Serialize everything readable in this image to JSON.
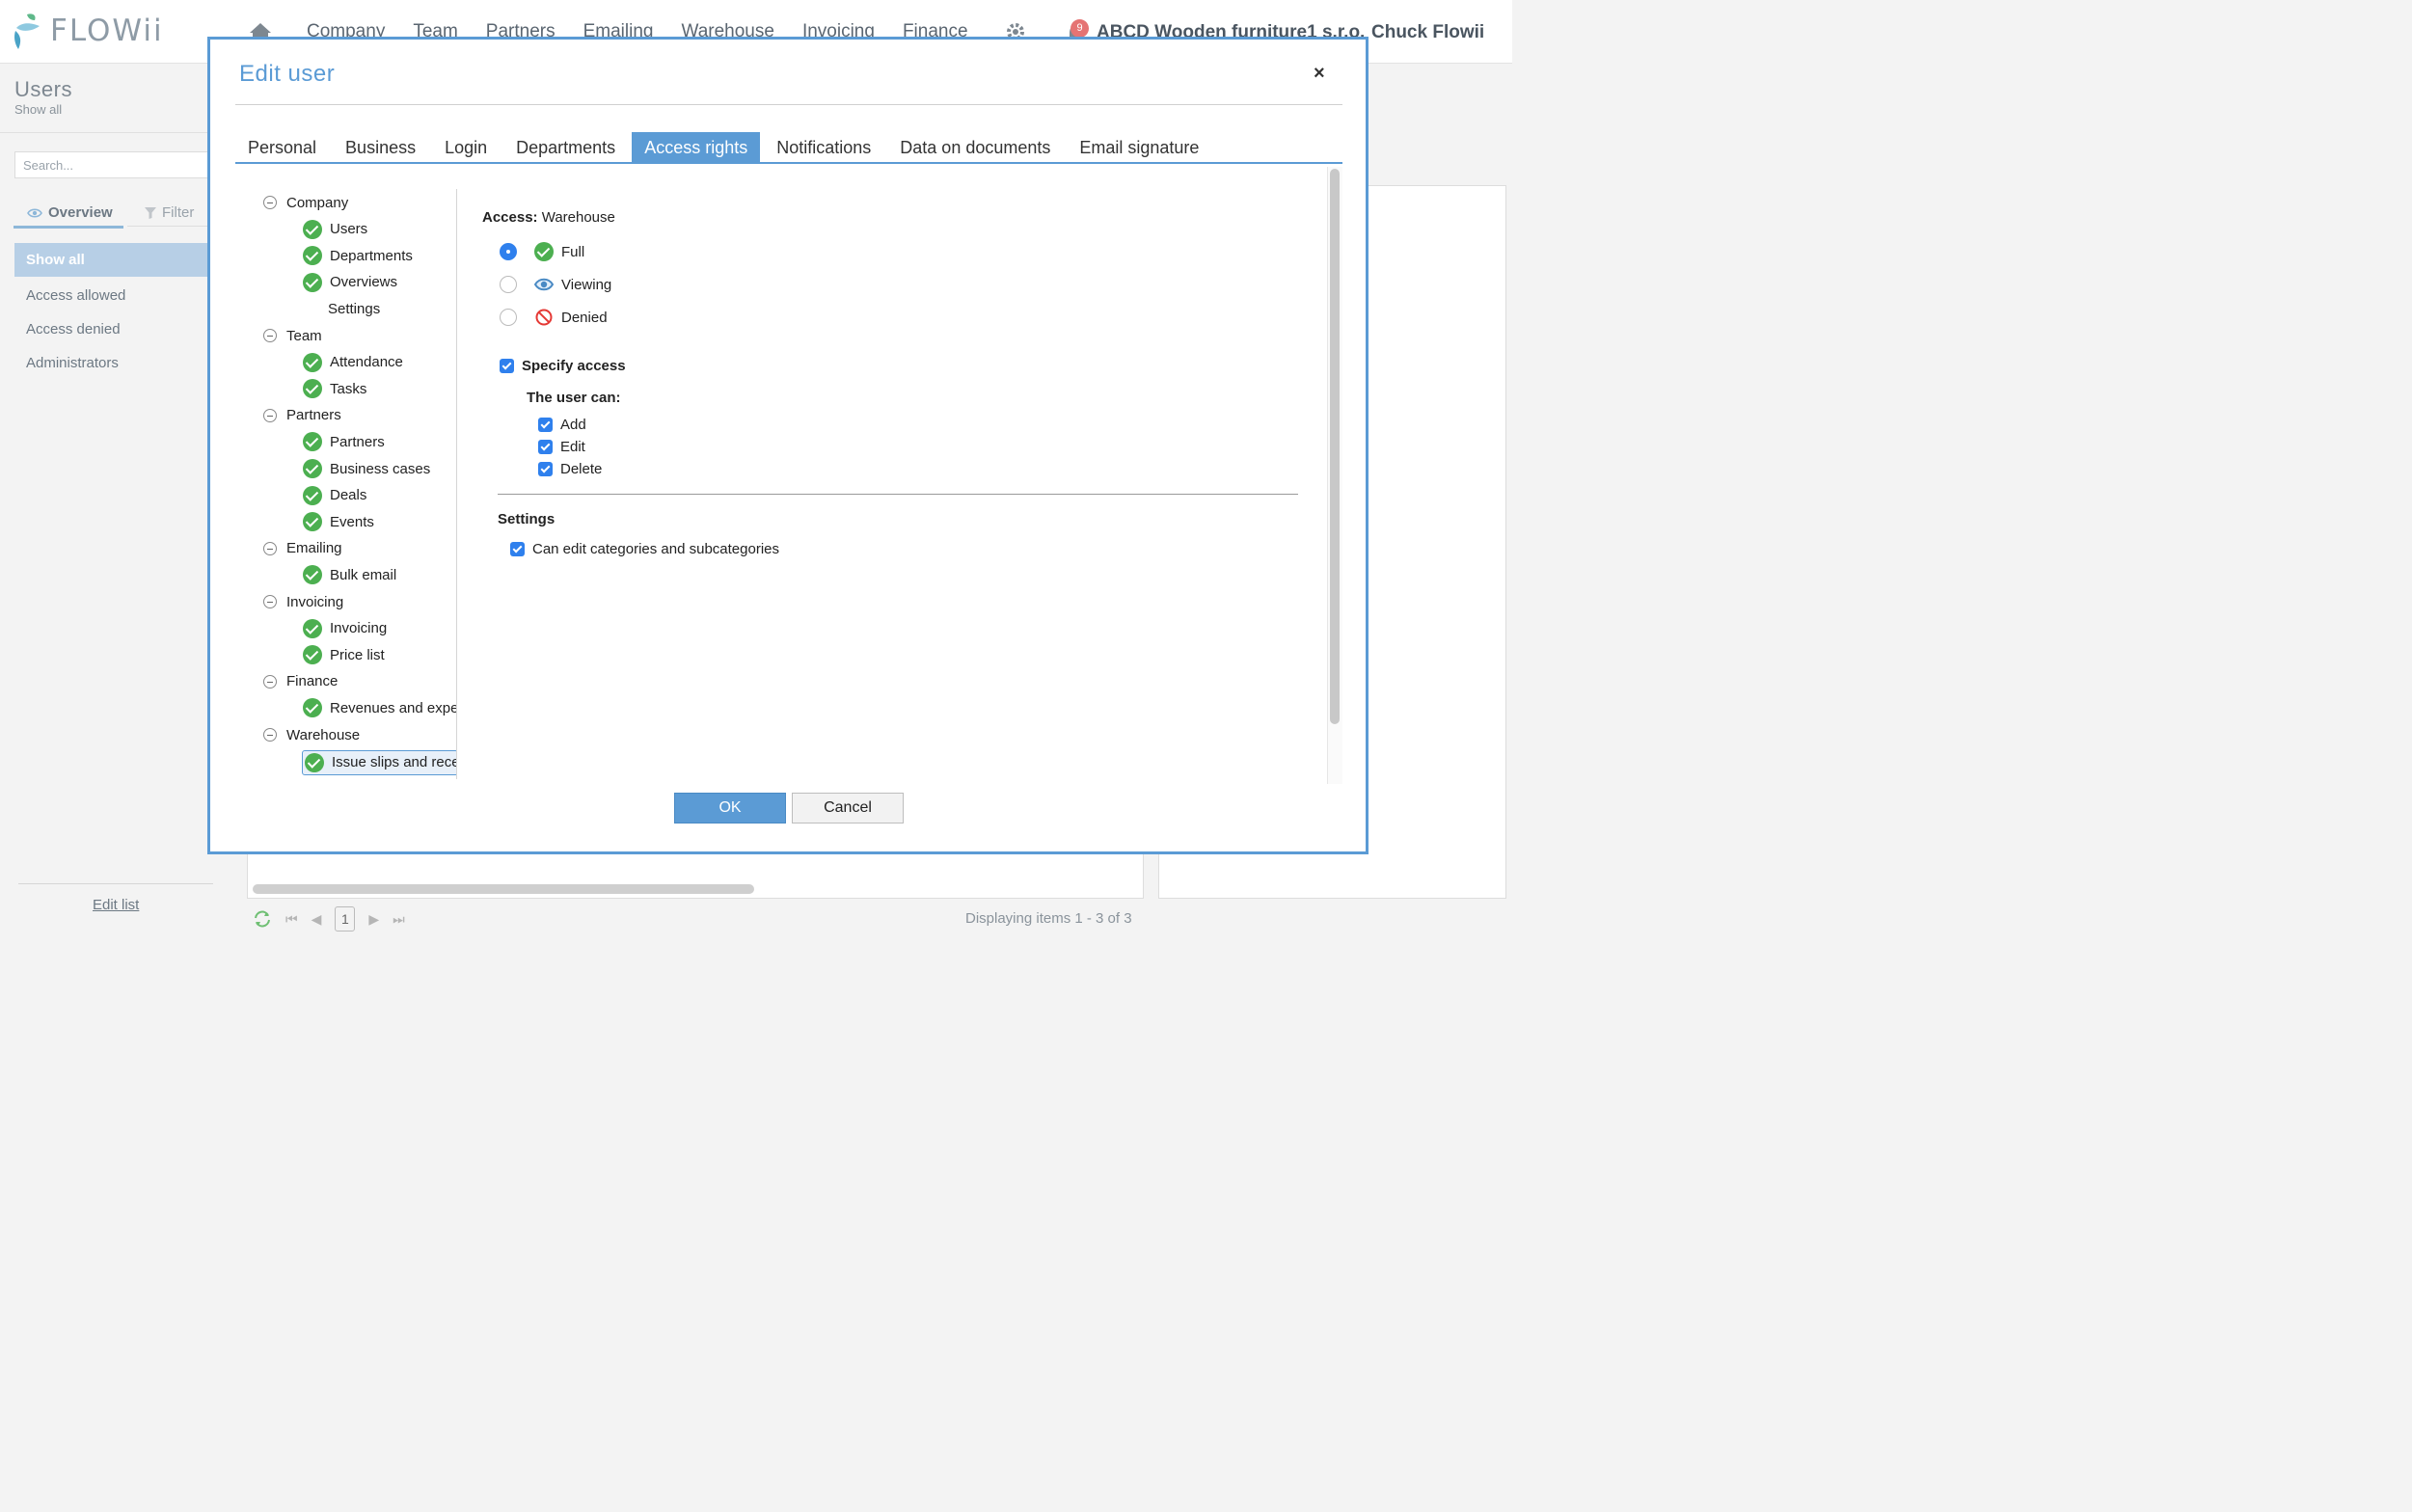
{
  "app": {
    "logo_text": "FLOWii"
  },
  "nav": {
    "items": [
      "Company",
      "Team",
      "Partners",
      "Emailing",
      "Warehouse",
      "Invoicing",
      "Finance"
    ],
    "company": "ABCD Wooden furniture1 s.r.o.",
    "user": "Chuck Flowii",
    "notifications_count": "9"
  },
  "left": {
    "title": "Users",
    "subtitle": "Show all",
    "search_placeholder": "Search...",
    "tab_overview": "Overview",
    "tab_filter": "Filter",
    "items": [
      "Show all",
      "Access allowed",
      "Access denied",
      "Administrators"
    ],
    "edit_list": "Edit list"
  },
  "pager": {
    "page": "1",
    "display": "Displaying items 1 - 3 of 3"
  },
  "modal": {
    "title": "Edit user",
    "close": "×",
    "tabs": [
      "Personal",
      "Business",
      "Login",
      "Departments",
      "Access rights",
      "Notifications",
      "Data on documents",
      "Email signature"
    ],
    "active_tab": "Access rights",
    "tree": [
      {
        "label": "Company",
        "level": 0
      },
      {
        "label": "Users",
        "level": 1,
        "check": true
      },
      {
        "label": "Departments",
        "level": 1,
        "check": true
      },
      {
        "label": "Overviews",
        "level": 1,
        "check": true
      },
      {
        "label": "Settings",
        "level": 1,
        "check": false
      },
      {
        "label": "Team",
        "level": 0
      },
      {
        "label": "Attendance",
        "level": 1,
        "check": true
      },
      {
        "label": "Tasks",
        "level": 1,
        "check": true
      },
      {
        "label": "Partners",
        "level": 0
      },
      {
        "label": "Partners",
        "level": 1,
        "check": true
      },
      {
        "label": "Business cases",
        "level": 1,
        "check": true
      },
      {
        "label": "Deals",
        "level": 1,
        "check": true
      },
      {
        "label": "Events",
        "level": 1,
        "check": true
      },
      {
        "label": "Emailing",
        "level": 0
      },
      {
        "label": "Bulk email",
        "level": 1,
        "check": true
      },
      {
        "label": "Invoicing",
        "level": 0
      },
      {
        "label": "Invoicing",
        "level": 1,
        "check": true
      },
      {
        "label": "Price list",
        "level": 1,
        "check": true
      },
      {
        "label": "Finance",
        "level": 0
      },
      {
        "label": "Revenues and expenses",
        "level": 1,
        "check": true
      },
      {
        "label": "Warehouse",
        "level": 0
      },
      {
        "label": "Issue slips and receipts",
        "level": 1,
        "check": true,
        "selected": true
      }
    ],
    "access_prefix": "Access:",
    "access_module": "Warehouse",
    "options": [
      {
        "label": "Full",
        "icon": "check-circle-icon",
        "selected": true
      },
      {
        "label": "Viewing",
        "icon": "eye-icon",
        "selected": false
      },
      {
        "label": "Denied",
        "icon": "denied-icon",
        "selected": false
      }
    ],
    "specify_access": "Specify access",
    "user_can": "The user can:",
    "perms": [
      "Add",
      "Edit",
      "Delete"
    ],
    "settings_title": "Settings",
    "setting_option": "Can edit categories and subcategories",
    "ok": "OK",
    "cancel": "Cancel"
  },
  "colors": {
    "accent": "#5b9bd5",
    "check_green": "#4caf50",
    "checkbox_blue": "#2f80ed",
    "denied_red": "#e53935"
  }
}
